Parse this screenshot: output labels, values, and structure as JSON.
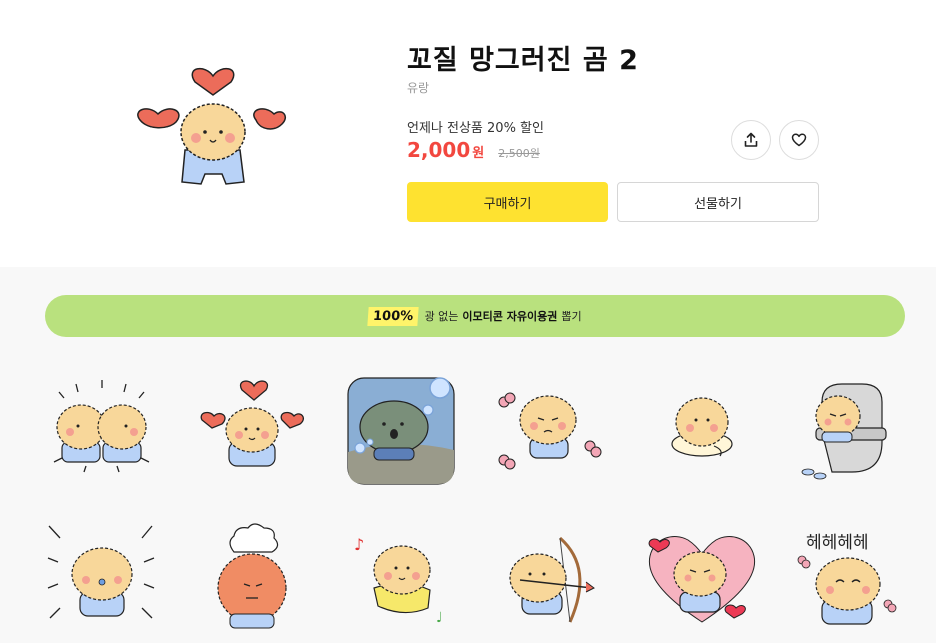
{
  "product": {
    "title": "꼬질 망그러진 곰 2",
    "author": "유랑",
    "promo": "언제나 전상품 20% 할인",
    "price": "2,000",
    "price_unit": "원",
    "original_price": "2,500원"
  },
  "actions": {
    "buy_label": "구매하기",
    "gift_label": "선물하기",
    "share_icon": "share-icon",
    "like_icon": "heart-icon"
  },
  "banner": {
    "badge": "100%",
    "text1": "광 없는",
    "text2": "이모티콘 자유이용권",
    "text3": "뽑기"
  },
  "stickers": {
    "s12_text": "헤헤헤헤"
  },
  "colors": {
    "accent_yellow": "#fee230",
    "price_red": "#f2473f",
    "banner_green": "#b9e17e",
    "bear_fur": "#f8d79a",
    "bear_shirt": "#b8d2f7",
    "heart": "#ec6c5a"
  }
}
